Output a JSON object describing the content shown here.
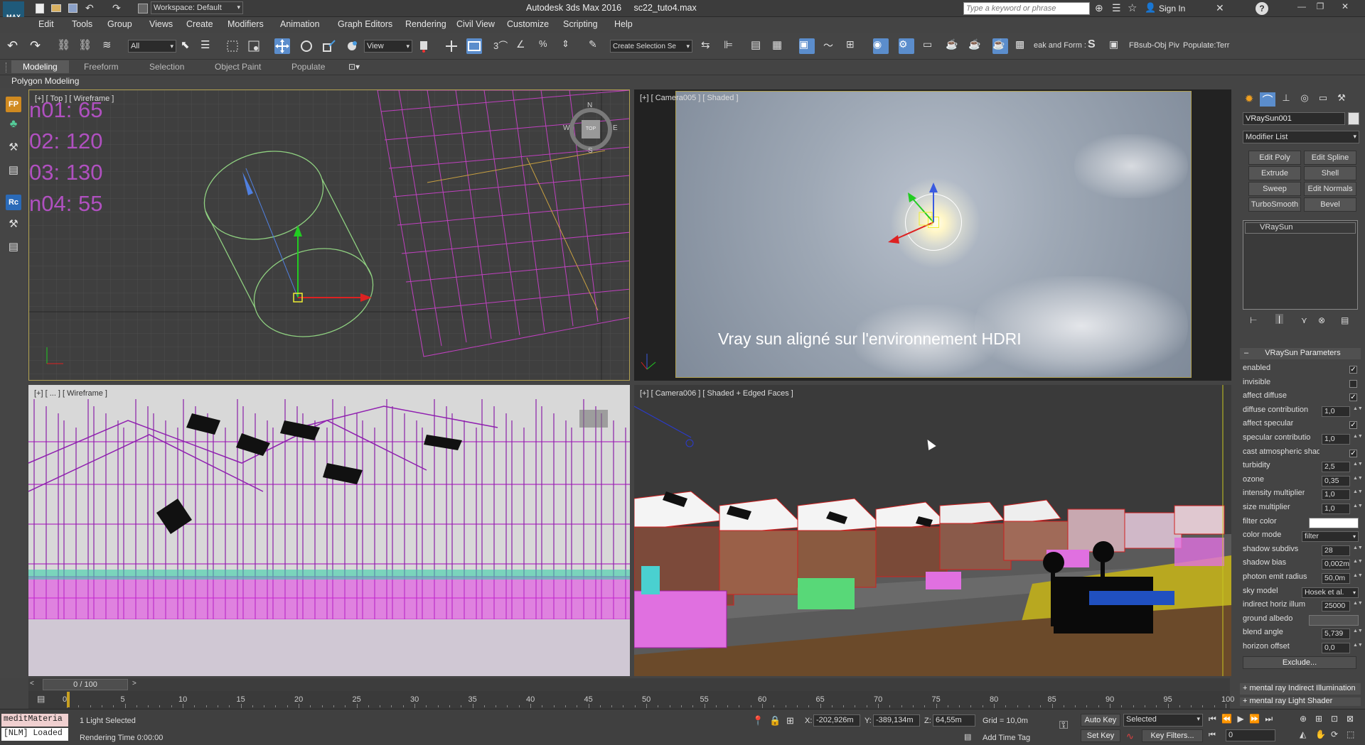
{
  "app": {
    "workspace": "Workspace: Default",
    "title": "Autodesk 3ds Max 2016",
    "filename": "sc22_tuto4.max",
    "search_placeholder": "Type a keyword or phrase",
    "sign_in": "Sign In"
  },
  "menu": [
    "Edit",
    "Tools",
    "Group",
    "Views",
    "Create",
    "Modifiers",
    "Animation",
    "Graph Editors",
    "Rendering",
    "Civil View",
    "Customize",
    "Scripting",
    "Help"
  ],
  "toolbar": {
    "filter": "All",
    "ref_coord": "View",
    "selection_set": "Create Selection Se",
    "text1": "eak and Form :",
    "text2": "FBsub-Obj Piv",
    "text3": "Populate:Terr"
  },
  "ribbon": {
    "tabs": [
      "Modeling",
      "Freeform",
      "Selection",
      "Object Paint",
      "Populate"
    ],
    "panel": "Polygon Modeling"
  },
  "viewports": {
    "top": {
      "label": "[+] [ Top ] [ Wireframe ]",
      "stats": [
        "n01: 65",
        "02: 120",
        "03: 130",
        "n04: 55"
      ],
      "compass_n": "N",
      "compass_s": "S",
      "compass_e": "E",
      "compass_w": "W",
      "compass_center": "TOP"
    },
    "cam5": {
      "label": "[+] [ Camera005 ] [ Shaded ]",
      "caption": "Vray sun aligné sur  l'environnement HDRI"
    },
    "persp": {
      "label": "[+] [ ... ] [ Wireframe ]"
    },
    "cam6": {
      "label": "[+] [ Camera006 ] [ Shaded + Edged Faces ]"
    }
  },
  "command_panel": {
    "object_name": "VRaySun001",
    "modifier_list": "Modifier List",
    "buttons": [
      "Edit Poly",
      "Edit Spline",
      "Extrude",
      "Shell",
      "Sweep",
      "Edit Normals",
      "TurboSmooth",
      "Bevel"
    ],
    "stack_item": "VRaySun",
    "rollout_title": "VRaySun Parameters",
    "params": [
      {
        "label": "enabled",
        "type": "check",
        "value": "✓"
      },
      {
        "label": "invisible",
        "type": "check",
        "value": ""
      },
      {
        "label": "affect diffuse",
        "type": "check",
        "value": "✓"
      },
      {
        "label": "diffuse contribution",
        "type": "num",
        "value": "1,0"
      },
      {
        "label": "affect specular",
        "type": "check",
        "value": "✓"
      },
      {
        "label": "specular contributio",
        "type": "num",
        "value": "1,0"
      },
      {
        "label": "cast atmospheric shadows",
        "type": "check",
        "value": "✓"
      },
      {
        "label": "turbidity",
        "type": "num",
        "value": "2,5"
      },
      {
        "label": "ozone",
        "type": "num",
        "value": "0,35"
      },
      {
        "label": "intensity multiplier",
        "type": "num",
        "value": "1,0"
      },
      {
        "label": "size multiplier",
        "type": "num",
        "value": "1,0"
      },
      {
        "label": "filter color",
        "type": "color",
        "value": ""
      },
      {
        "label": "color mode",
        "type": "drop",
        "value": "filter"
      },
      {
        "label": "shadow subdivs",
        "type": "num",
        "value": "28"
      },
      {
        "label": "shadow bias",
        "type": "num",
        "value": "0,002m"
      },
      {
        "label": "photon emit radius",
        "type": "num",
        "value": "50,0m"
      },
      {
        "label": "sky model",
        "type": "drop",
        "value": "Hosek et al."
      },
      {
        "label": "indirect horiz illum",
        "type": "num",
        "value": "25000"
      },
      {
        "label": "ground albedo",
        "type": "color",
        "value": ""
      },
      {
        "label": "blend angle",
        "type": "num",
        "value": "5,739"
      },
      {
        "label": "horizon offset",
        "type": "num",
        "value": "0,0"
      }
    ],
    "exclude": "Exclude...",
    "rollout2": "mental ray Indirect Illumination",
    "rollout3": "mental ray Light Shader"
  },
  "timeline": {
    "frame": "0 / 100",
    "ticks": [
      "0",
      "5",
      "10",
      "15",
      "20",
      "25",
      "30",
      "35",
      "40",
      "45",
      "50",
      "55",
      "60",
      "65",
      "70",
      "75",
      "80",
      "85",
      "90",
      "95",
      "100"
    ]
  },
  "status": {
    "script_listener": "meditMateria",
    "nlm": "[NLM] Loaded",
    "selection": "1 Light Selected",
    "render_time": "Rendering Time  0:00:00",
    "x": "-202,926m",
    "y": "-389,134m",
    "z": "64,55m",
    "grid": "Grid = 10,0m",
    "add_time_tag": "Add Time Tag",
    "auto_key": "Auto Key",
    "set_key": "Set Key",
    "selected": "Selected",
    "key_filters": "Key Filters...",
    "current_frame": "0"
  }
}
